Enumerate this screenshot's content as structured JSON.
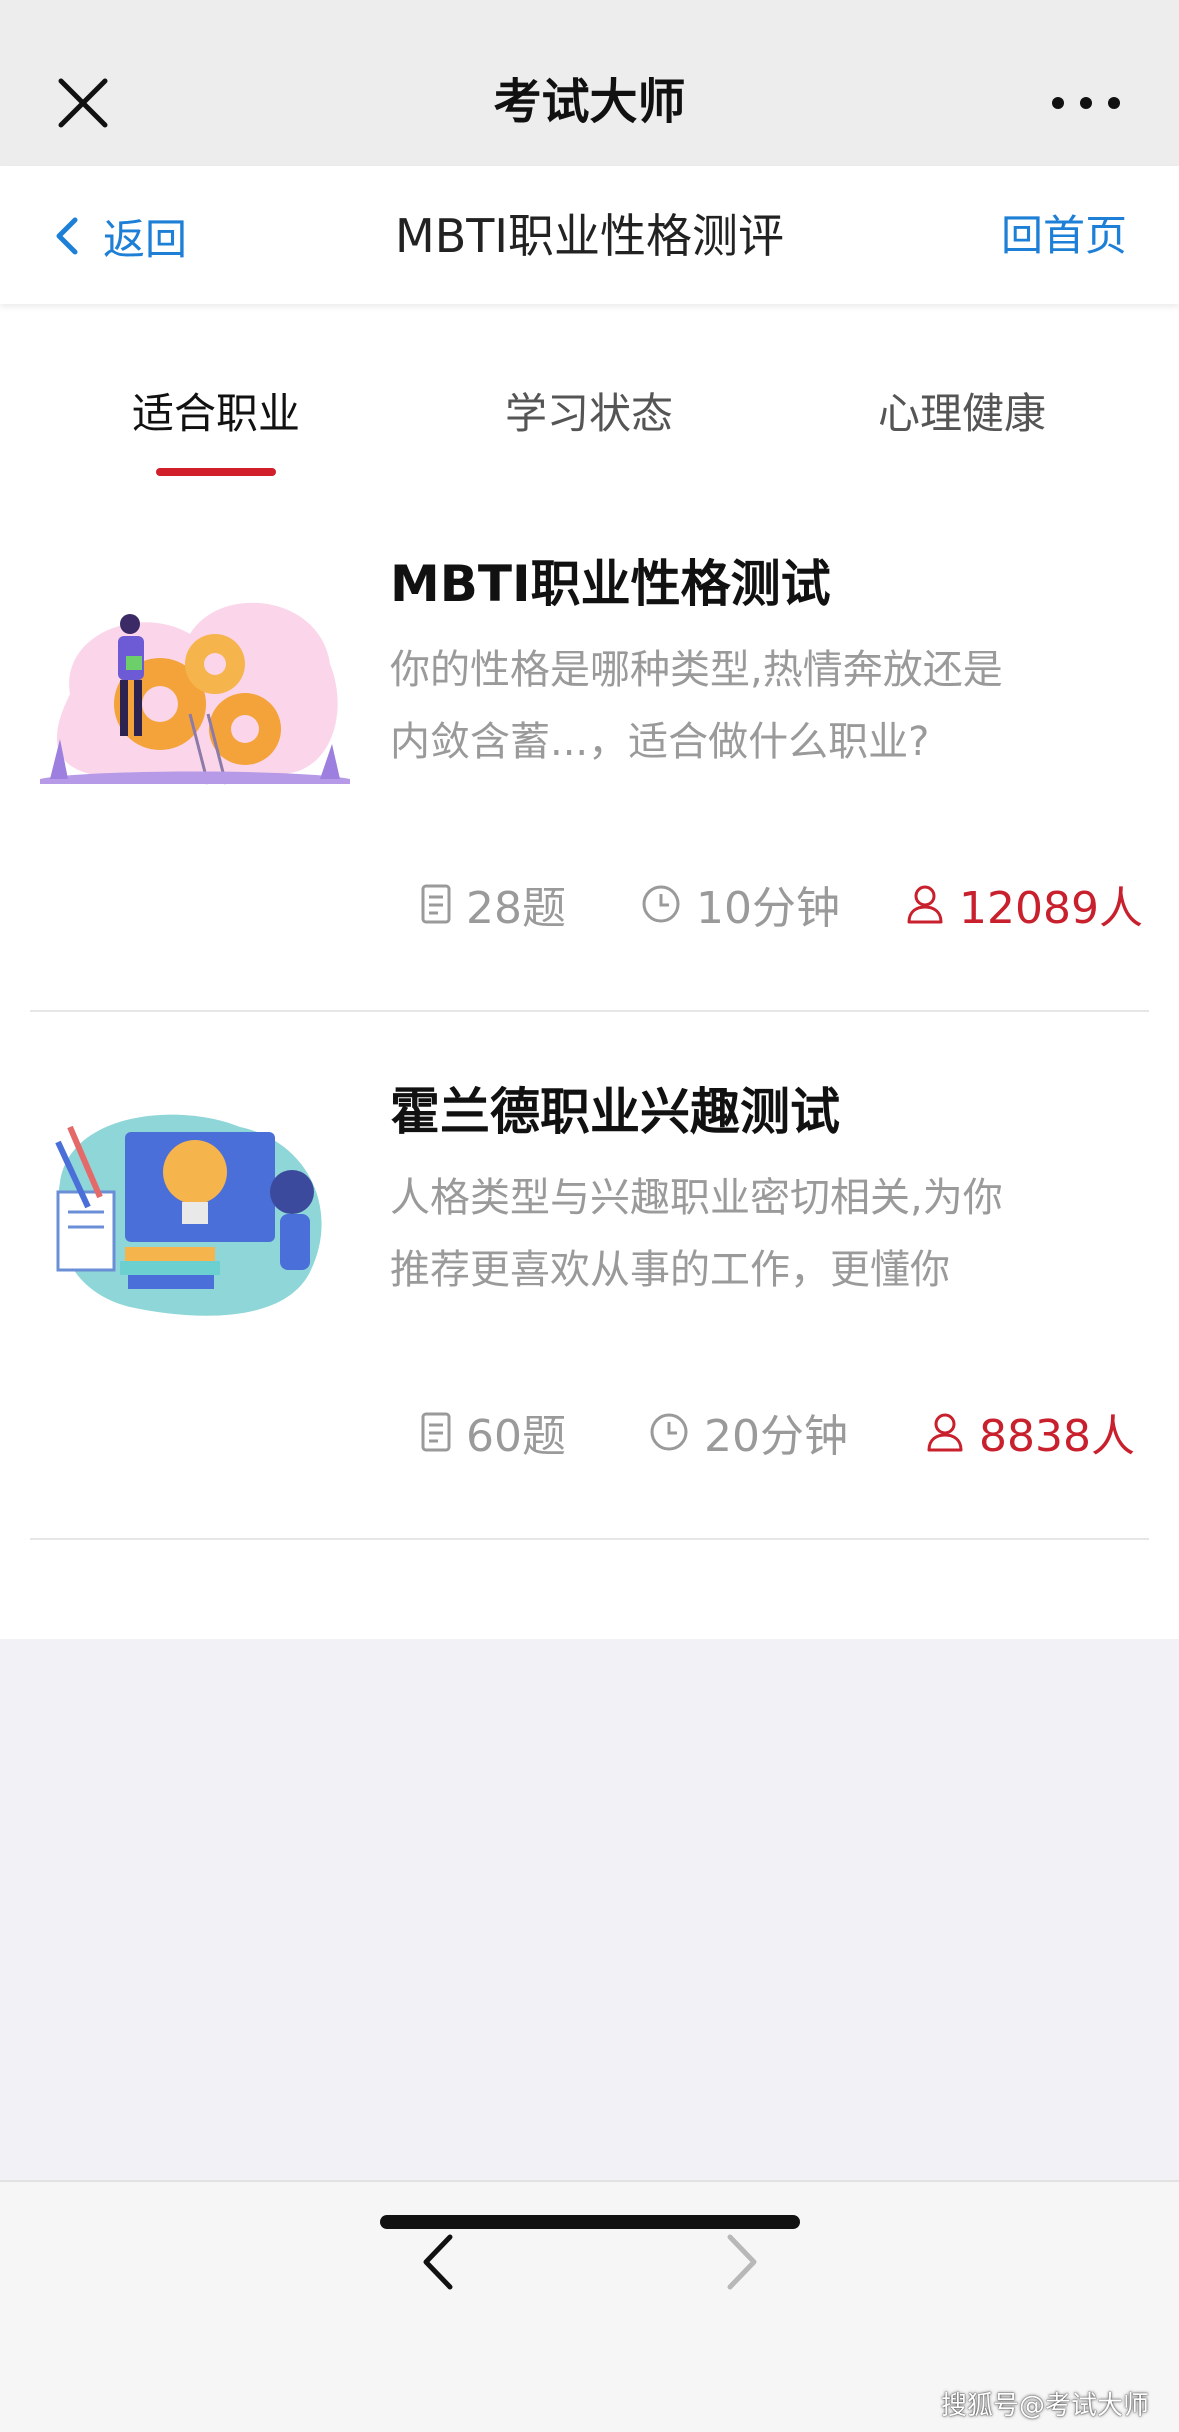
{
  "wechat": {
    "title": "考试大师"
  },
  "nav": {
    "back_label": "返回",
    "title": "MBTI职业性格测评",
    "home_label": "回首页"
  },
  "tabs": [
    {
      "label": "适合职业",
      "active": true
    },
    {
      "label": "学习状态",
      "active": false
    },
    {
      "label": "心理健康",
      "active": false
    }
  ],
  "tests": [
    {
      "title": "MBTI职业性格测试",
      "desc_line1": "你的性格是哪种类型,热情奔放还是",
      "desc_line2": "内敛含蓄...，适合做什么职业?",
      "questions": "28题",
      "duration": "10分钟",
      "people": "12089人",
      "illustration": "person-with-gears-illustration"
    },
    {
      "title": "霍兰德职业兴趣测试",
      "desc_line1": "人格类型与兴趣职业密切相关,为你",
      "desc_line2": "推荐更喜欢从事的工作，更懂你",
      "questions": "60题",
      "duration": "20分钟",
      "people": "8838人",
      "illustration": "lightbulb-books-illustration"
    }
  ],
  "icons": {
    "close": "close-icon",
    "more": "more-dots-icon",
    "back": "chevron-left-icon",
    "questions": "document-icon",
    "duration": "clock-icon",
    "people": "person-icon",
    "browser_back": "chevron-left-icon",
    "browser_forward": "chevron-right-icon"
  },
  "colors": {
    "accent_red": "#d21f2c",
    "link_blue": "#1d7fd6",
    "text_gray": "#9a9a9a"
  },
  "watermark": "搜狐号@考试大师"
}
